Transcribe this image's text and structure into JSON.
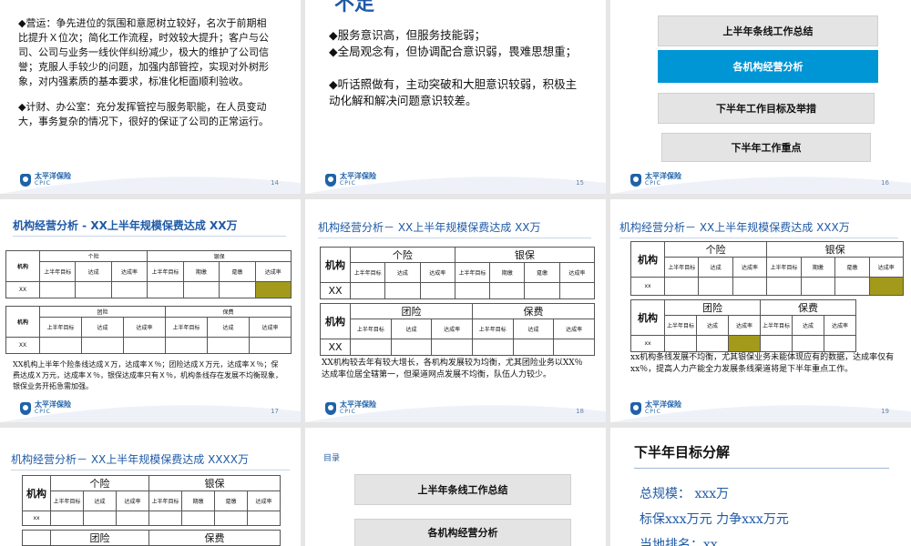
{
  "brand": {
    "name": "太平洋保险",
    "sub": "CPIC"
  },
  "slides": {
    "s14": {
      "page": "14",
      "p1": "◆营运：争先进位的氛围和意愿树立较好，名次于前期相比提升Ｘ位次；简化工作流程，时效较大提升；客户与公司、公司与业务一线伙伴纠纷减少，极大的维护了公司信誉；克服人手较少的问题，加强内部管控，实现对外树形象，对内强素质的基本要求，标准化柜面顺利验收。",
      "p2": "◆计财、办公室：充分发挥管控与服务职能，在人员变动大，事务复杂的情况下，很好的保证了公司的正常运行。"
    },
    "s15": {
      "page": "15",
      "title": "不足",
      "p1": "◆服务意识高，但服务技能弱；",
      "p2": "◆全局观念有，但协调配合意识弱，畏难思想重；",
      "p3": "◆听话照做有，主动突破和大胆意识较弱，积极主动化解和解决问题意识较差。"
    },
    "s16": {
      "page": "16",
      "items": [
        "上半年条线工作总结",
        "各机构经营分析",
        "下半年工作目标及举措",
        "下半年工作重点"
      ]
    },
    "s17": {
      "page": "17",
      "title": "机构经营分析 - XX上半年规模保费达成 XX万",
      "hdr1": [
        "个险",
        "银保"
      ],
      "hdr2": [
        "团险",
        "保费"
      ],
      "org": "机构",
      "cols1": [
        "上半年目标",
        "达成",
        "达成率",
        "上半年目标",
        "期缴",
        "趸缴",
        "达成率"
      ],
      "cols2": [
        "上半年目标",
        "达成",
        "达成率",
        "上半年目标",
        "达成",
        "达成率"
      ],
      "row": "XX",
      "note": "XX机构上半年个险条线达成Ｘ万，达成率Ｘ％；团险达成Ｘ万元，达成率Ｘ％；保费达成Ｘ万元，达成率Ｘ％，银保达成率只有Ｘ％，机构条线存在发展不均衡现象，银保业务开拓急需加强。"
    },
    "s18": {
      "page": "18",
      "title": "机构经营分析－ XX上半年规模保费达成 XX万",
      "hdr1": [
        "个险",
        "银保"
      ],
      "hdr2": [
        "团险",
        "保费"
      ],
      "org": "机构",
      "cols1": [
        "上半年目标",
        "达成",
        "达成率",
        "上半年目标",
        "期缴",
        "趸缴",
        "达成率"
      ],
      "cols2": [
        "上半年目标",
        "达成",
        "达成率",
        "上半年目标",
        "达成",
        "达成率"
      ],
      "row": "XX",
      "note": "XX机构较去年有较大增长，各机构发展较为均衡，尤其团险业务以XX％达成率位居全辖第一，但渠道网点发展不均衡，队伍人力较少。"
    },
    "s19": {
      "page": "19",
      "title": "机构经营分析－ XX上半年规模保费达成 XXX万",
      "hdr1": [
        "个险",
        "银保"
      ],
      "hdr2": [
        "团险",
        "保费"
      ],
      "org": "机构",
      "cols1": [
        "上半年目标",
        "达成",
        "达成率",
        "上半年目标",
        "期缴",
        "趸缴",
        "达成率"
      ],
      "cols2": [
        "上半年目标",
        "达成",
        "达成率",
        "上半年目标",
        "达成",
        "达成率"
      ],
      "row": "xx",
      "note": "xx机构条线发展不均衡，尤其银保业务未能体现应有的数据，达成率仅有xx％，提高人力产能全力发展条线渠道将是下半年重点工作。"
    },
    "s20": {
      "title": "机构经营分析－ XX上半年规模保费达成 XXXX万",
      "hdr1": [
        "个险",
        "银保"
      ],
      "hdr2": [
        "团险",
        "保费"
      ],
      "org": "机构",
      "cols1": [
        "上半年目标",
        "达成",
        "达成率",
        "上半年目标",
        "期缴",
        "趸缴",
        "达成率"
      ],
      "row": "xx"
    },
    "s21": {
      "label": "目录",
      "items": [
        "上半年条线工作总结",
        "各机构经营分析"
      ]
    },
    "s22": {
      "title": "下半年目标分解",
      "l1": "总规模：  xxx万",
      "l2": "标保xxx万元    力争xxx万元",
      "l3": "当地排名：xx"
    }
  }
}
